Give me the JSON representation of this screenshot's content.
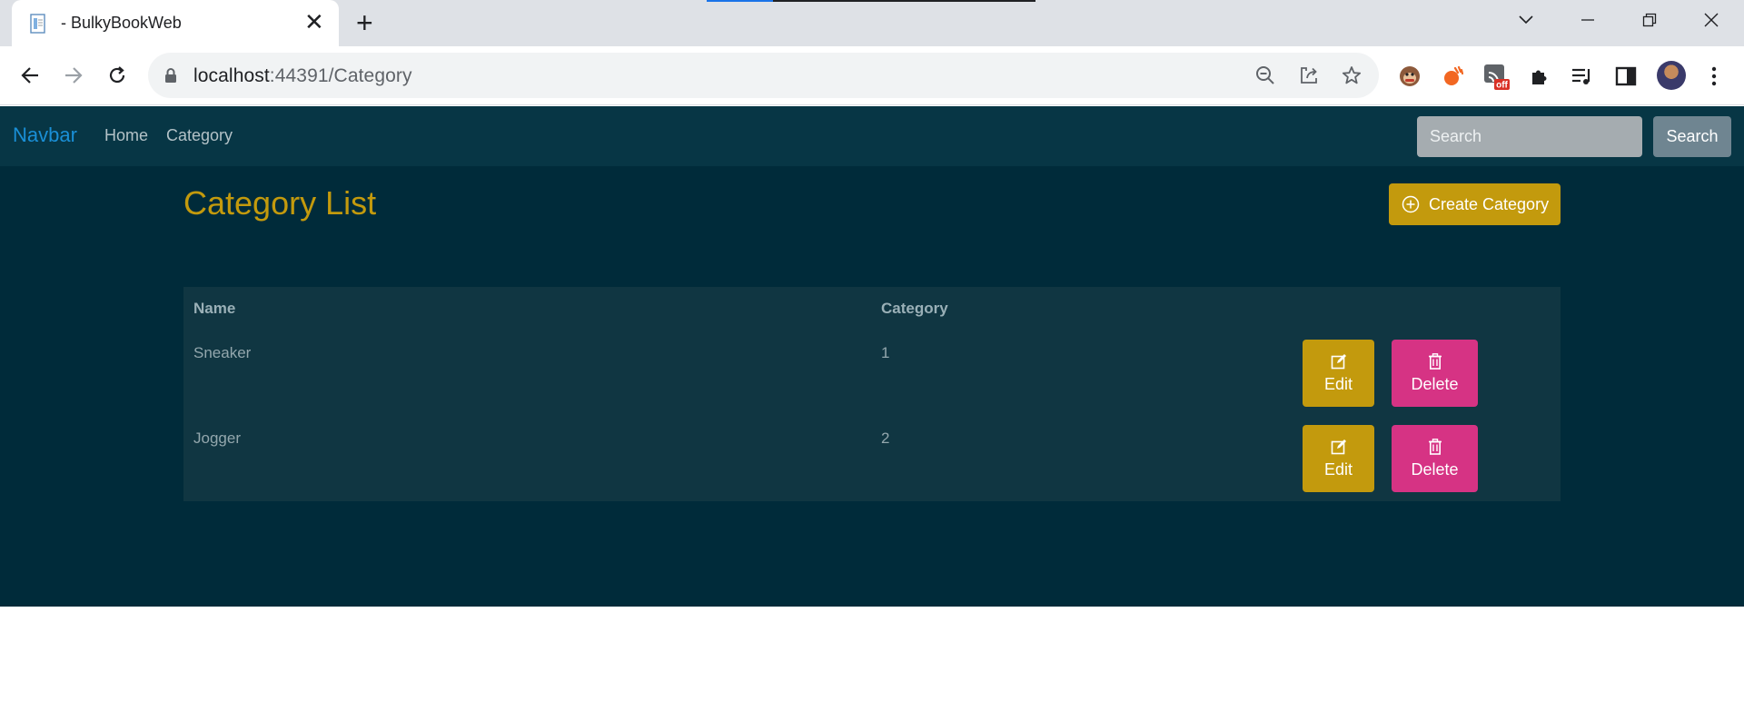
{
  "browser": {
    "tab_title": "- BulkyBookWeb",
    "url_host": "localhost",
    "url_path": ":44391/Category",
    "extension_badge": "off"
  },
  "navbar": {
    "brand": "Navbar",
    "links": [
      "Home",
      "Category"
    ],
    "search_placeholder": "Search",
    "search_button": "Search"
  },
  "main": {
    "title": "Category List",
    "create_button": "Create Category",
    "table": {
      "headers": [
        "Name",
        "Category"
      ],
      "rows": [
        {
          "name": "Sneaker",
          "category": "1"
        },
        {
          "name": "Jogger",
          "category": "2"
        }
      ],
      "edit_label": "Edit",
      "delete_label": "Delete"
    }
  },
  "colors": {
    "accent": "#c39a0d",
    "danger": "#d63384",
    "page_bg": "#002b3a",
    "navbar_bg": "#073645",
    "brand": "#1a8fd6"
  }
}
